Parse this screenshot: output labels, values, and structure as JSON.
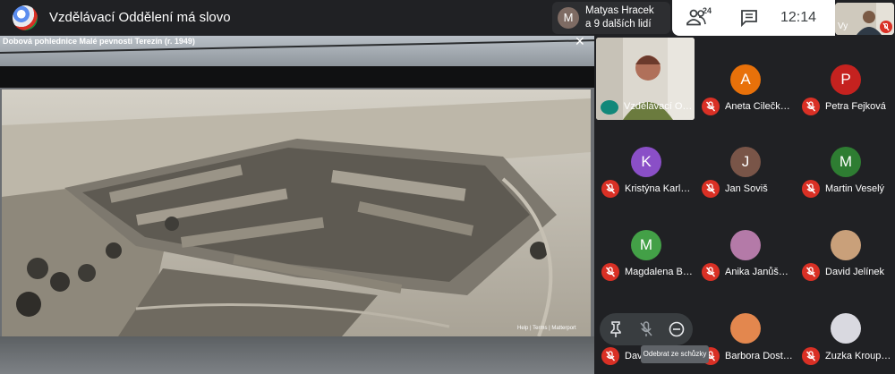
{
  "meeting": {
    "title": "Vzdělávací Oddělení má slovo"
  },
  "join_notice": {
    "initial": "M",
    "name": "Matyas Hracek",
    "more": "a 9 dalších lidí"
  },
  "toolbar": {
    "people_count": "24",
    "time": "12:14"
  },
  "self_view": {
    "label": "Vy"
  },
  "screen_share": {
    "title": "Dobová pohlednice Malé pevnosti Terezín (r. 1949)",
    "close": "✕",
    "footer": "Help | Terms | Matterport"
  },
  "participants": [
    {
      "name": "Vzdělávací O…",
      "type": "video"
    },
    {
      "name": "Aneta Cilečk…",
      "initial": "A",
      "color": "#e8710a"
    },
    {
      "name": "Petra Fejková",
      "initial": "P",
      "color": "#c5221f"
    },
    {
      "name": "Kristýna Karl…",
      "initial": "K",
      "color": "#8a4fc7"
    },
    {
      "name": "Jan Soviš",
      "initial": "J",
      "color": "#795548"
    },
    {
      "name": "Martin Veselý",
      "initial": "M",
      "color": "#2e7d32"
    },
    {
      "name": "Magdalena B…",
      "initial": "M",
      "color": "#43a047"
    },
    {
      "name": "Anika Janůš…",
      "type": "photo",
      "color": "#b47aa8"
    },
    {
      "name": "David Jelínek",
      "type": "photo",
      "color": "#c9a07a"
    },
    {
      "name": "Dav…",
      "type": "hover"
    },
    {
      "name": "Barbora Dost…",
      "type": "photo",
      "color": "#e3874e"
    },
    {
      "name": "Zuzka Kroup…",
      "type": "photo",
      "color": "#d9d9e0"
    }
  ],
  "hover_menu": {
    "tooltip": "Odebrat ze schůzky"
  },
  "colors": {
    "background": "#202124",
    "mic_off": "#d93025",
    "speaking": "#11887a"
  }
}
